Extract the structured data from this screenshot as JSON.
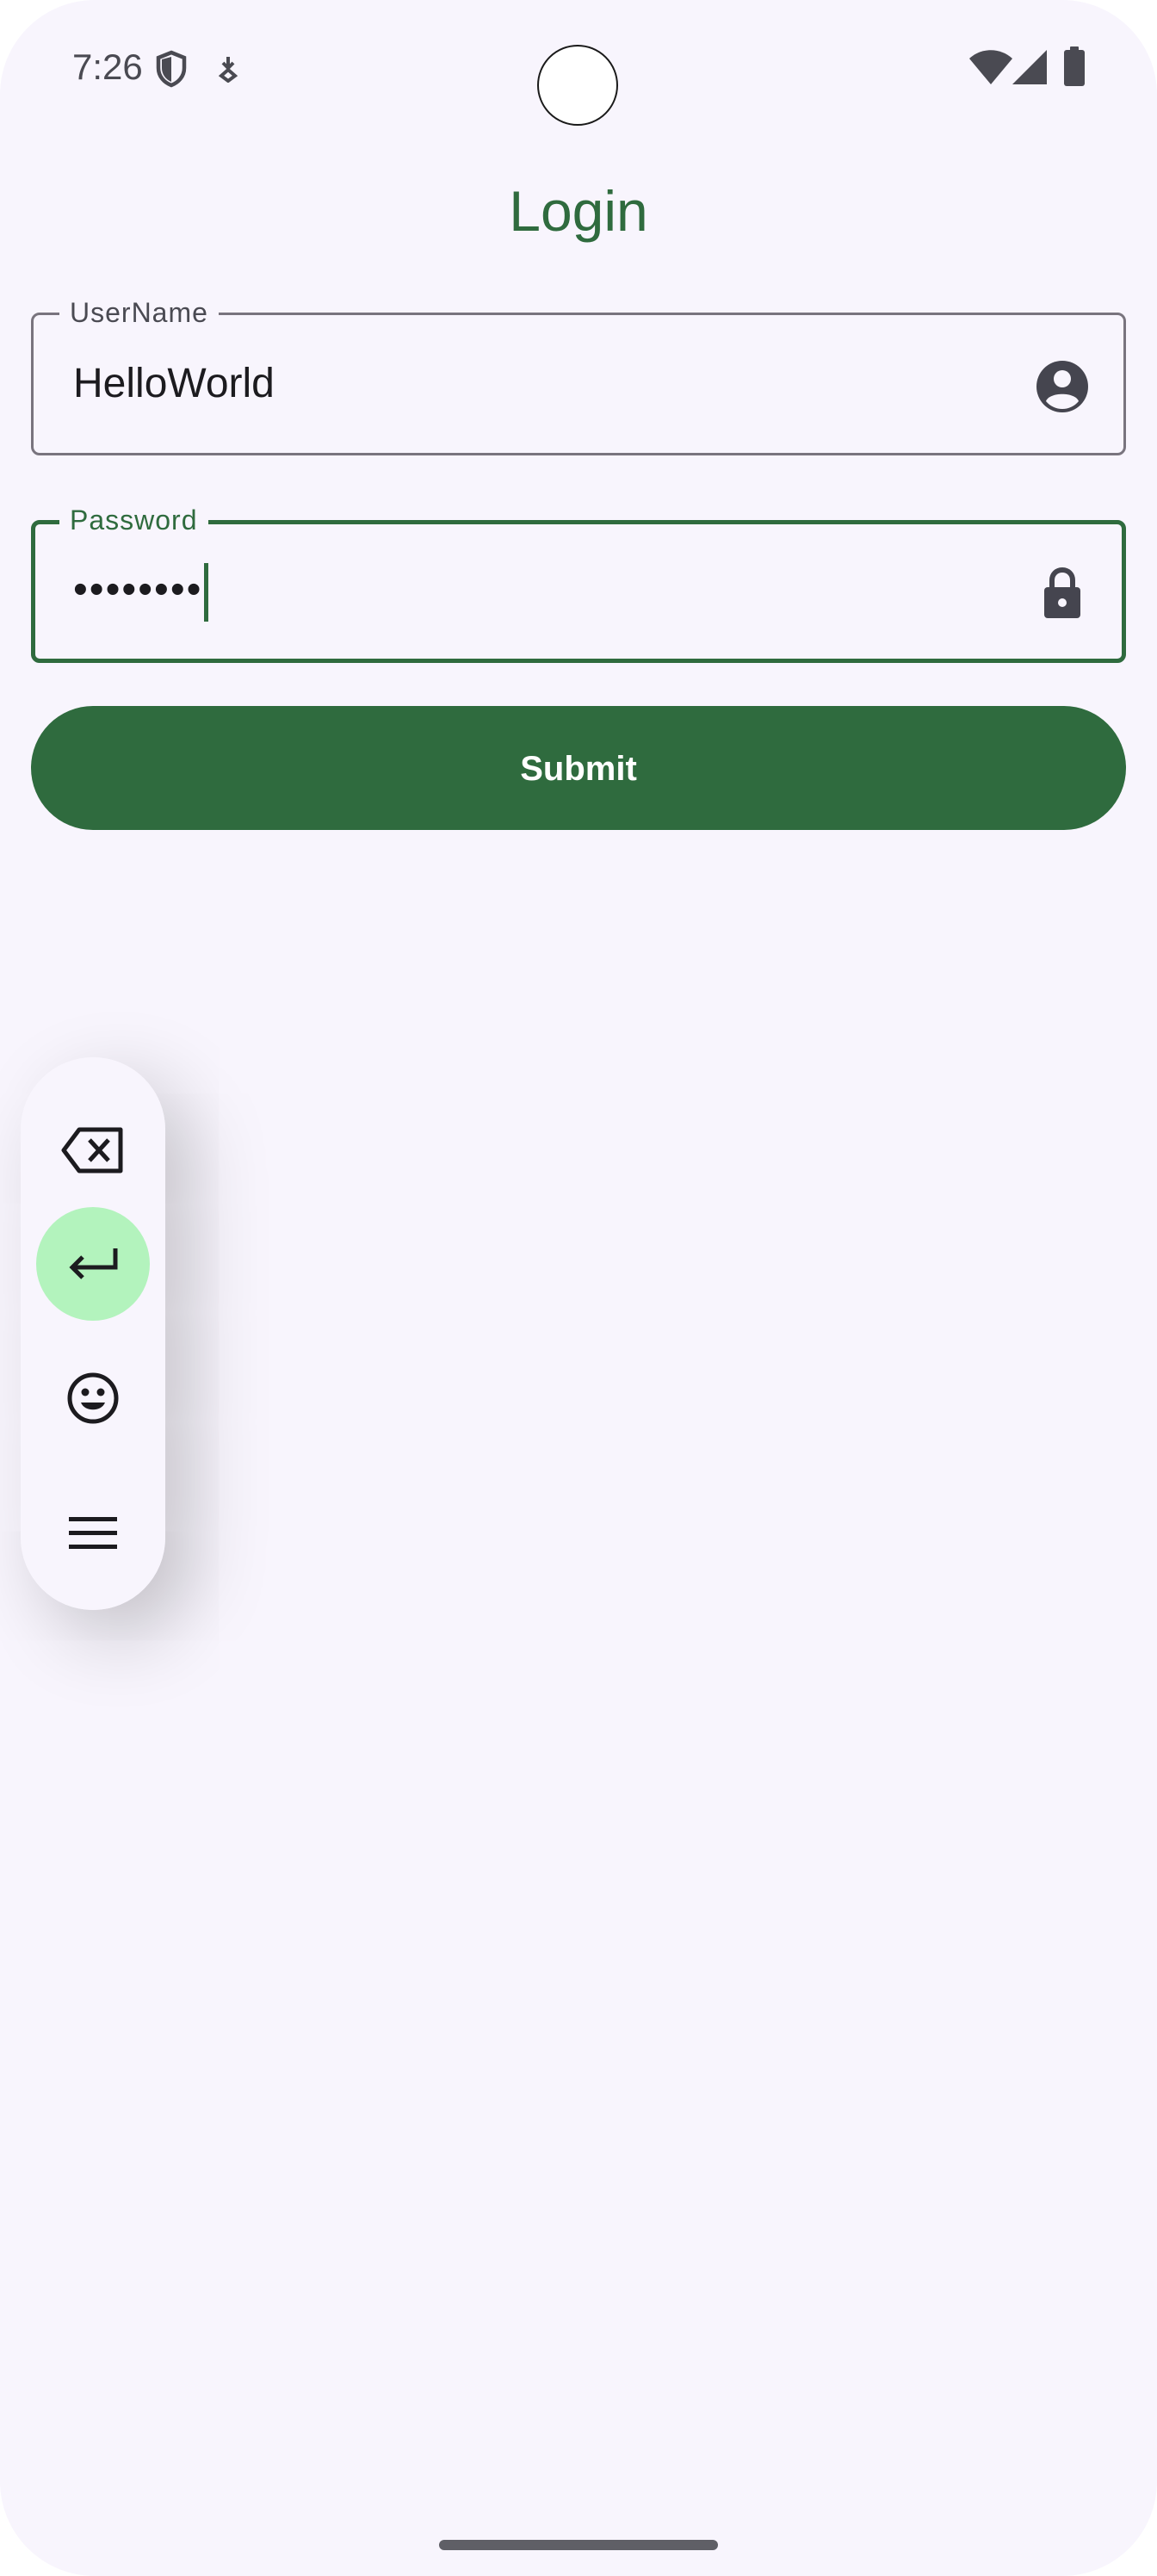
{
  "status_bar": {
    "time": "7:26",
    "left_icons": [
      "shield-icon",
      "download-indicator-icon"
    ],
    "right_icons": [
      "wifi-icon",
      "signal-icon",
      "battery-icon"
    ]
  },
  "login": {
    "title": "Login",
    "username": {
      "label": "UserName",
      "value": "HelloWorld",
      "icon": "account-circle-icon"
    },
    "password": {
      "label": "Password",
      "value": "••••••••",
      "icon": "lock-icon",
      "focused": true
    },
    "submit_label": "Submit"
  },
  "keyboard_toolbar": {
    "buttons": [
      "backspace-icon",
      "enter-icon",
      "emoji-icon",
      "menu-icon"
    ],
    "active": "enter-icon"
  },
  "colors": {
    "primary": "#2f6b3e",
    "background": "#f8f5fd",
    "active_key": "#b3f3bd",
    "outline": "#79747e"
  }
}
